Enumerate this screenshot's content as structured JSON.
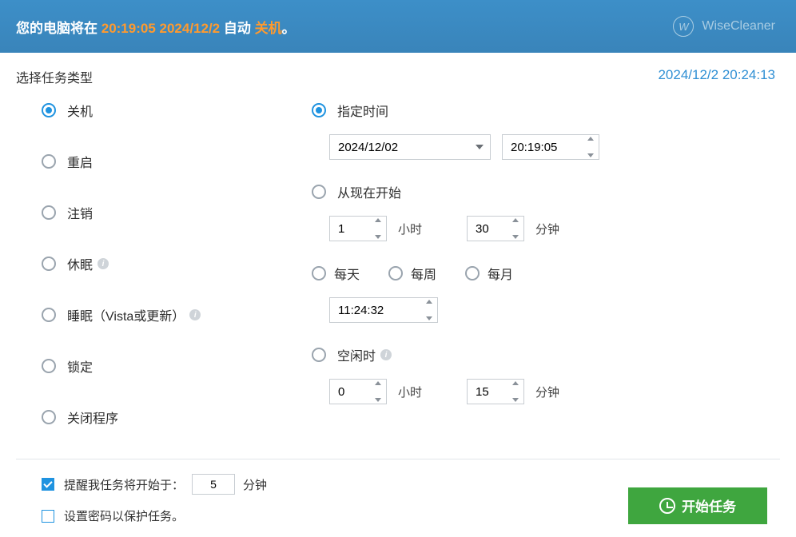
{
  "header": {
    "msg_prefix": "您的电脑将在 ",
    "msg_time": "20:19:05 2024/12/2",
    "msg_mid": " 自动 ",
    "msg_action": "关机",
    "msg_suffix": "。",
    "brand": "WiseCleaner",
    "brand_letter": "W"
  },
  "subhead": {
    "title": "选择任务类型",
    "clock": "2024/12/2 20:24:13"
  },
  "taskTypes": [
    {
      "label": "关机",
      "checked": true,
      "info": false
    },
    {
      "label": "重启",
      "checked": false,
      "info": false
    },
    {
      "label": "注销",
      "checked": false,
      "info": false
    },
    {
      "label": "休眠",
      "checked": false,
      "info": true
    },
    {
      "label": "睡眠（Vista或更新）",
      "checked": false,
      "info": true
    },
    {
      "label": "锁定",
      "checked": false,
      "info": false
    },
    {
      "label": "关闭程序",
      "checked": false,
      "info": false
    }
  ],
  "schedule": {
    "specific": {
      "label": "指定时间",
      "checked": true,
      "date": "2024/12/02",
      "time": "20:19:05"
    },
    "fromnow": {
      "label": "从现在开始",
      "checked": false,
      "hours": "1",
      "hours_unit": "小时",
      "minutes": "30",
      "minutes_unit": "分钟"
    },
    "recur": {
      "daily": {
        "label": "每天",
        "checked": false
      },
      "weekly": {
        "label": "每周",
        "checked": false
      },
      "monthly": {
        "label": "每月",
        "checked": false
      },
      "time": "11:24:32"
    },
    "idle": {
      "label": "空闲时",
      "checked": false,
      "info": true,
      "hours": "0",
      "hours_unit": "小时",
      "minutes": "15",
      "minutes_unit": "分钟"
    }
  },
  "footer": {
    "remind_label": "提醒我任务将开始于：",
    "remind_value": "5",
    "remind_unit": "分钟",
    "remind_checked": true,
    "password_label": "设置密码以保护任务。",
    "password_checked": false,
    "start_button": "开始任务"
  }
}
